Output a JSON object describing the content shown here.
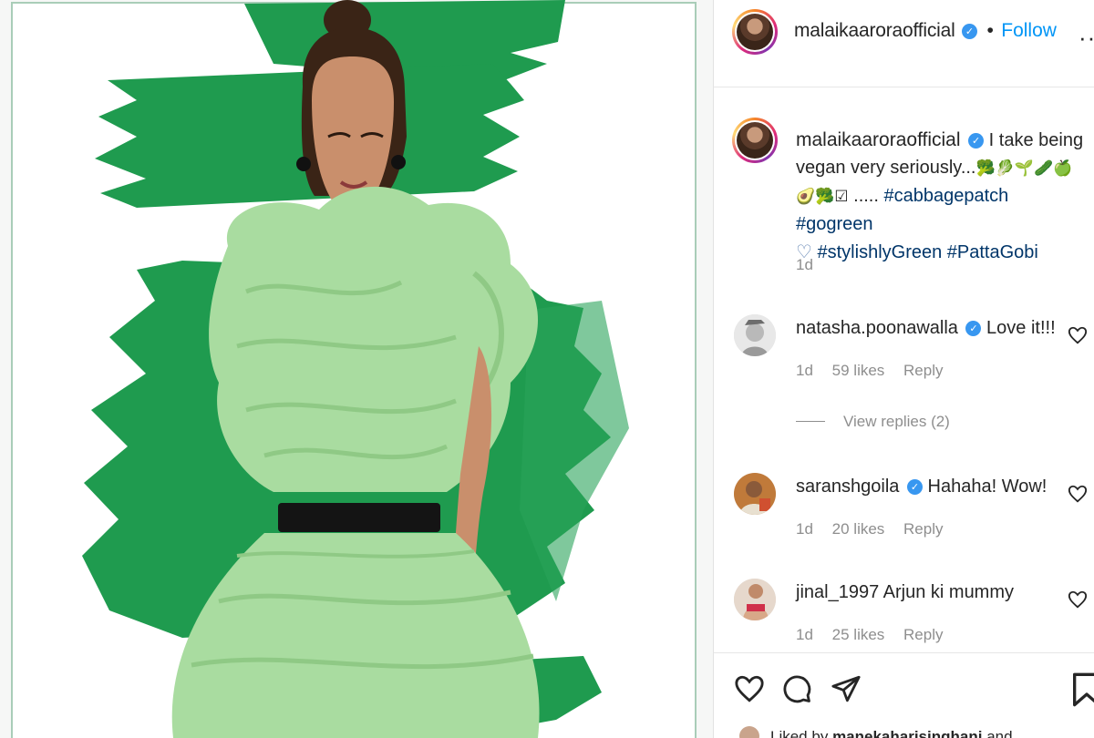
{
  "colors": {
    "accent": "#0095f6",
    "verified": "#3897f0",
    "hashtag": "#003569",
    "muted": "#8e8e8e",
    "brush_green": "#1f9b4f",
    "dress_green": "#a9dca0"
  },
  "post": {
    "author": "malaikaaroraofficial",
    "verified_icon": "verified-badge-icon",
    "follow_label": "Follow",
    "more_icon": "more-options-icon"
  },
  "caption": {
    "author": "malaikaaroraofficial",
    "text": "I take being vegan very seriously...",
    "emojis": "🥦🥬🌱🥒🍏",
    "emojis_line2": "🥑🥦☑",
    "ellipsis": ".....",
    "hashtags": [
      "#cabbagepatch",
      "#gogreen"
    ],
    "heart": "♡",
    "hashtags2": [
      "#stylishlyGreen",
      "#PattaGobi"
    ],
    "time": "1d"
  },
  "comments": [
    {
      "user": "natasha.poonawalla",
      "verified": true,
      "text": "Love it!!!",
      "time": "1d",
      "likes": "59 likes",
      "reply": "Reply"
    },
    {
      "user": "saranshgoila",
      "verified": true,
      "text": "Hahaha! Wow!",
      "time": "1d",
      "likes": "20 likes",
      "reply": "Reply"
    },
    {
      "user": "jinal_1997",
      "verified": false,
      "text": "Arjun ki mummy",
      "time": "1d",
      "likes": "25 likes",
      "reply": "Reply"
    }
  ],
  "view_replies": "View replies (2)",
  "actions": {
    "like_icon": "heart-icon",
    "comment_icon": "comment-icon",
    "share_icon": "send-icon",
    "save_icon": "bookmark-icon"
  },
  "liked_by": {
    "prefix": "Liked by",
    "user": "manekaharisinghani",
    "suffix": "and"
  }
}
